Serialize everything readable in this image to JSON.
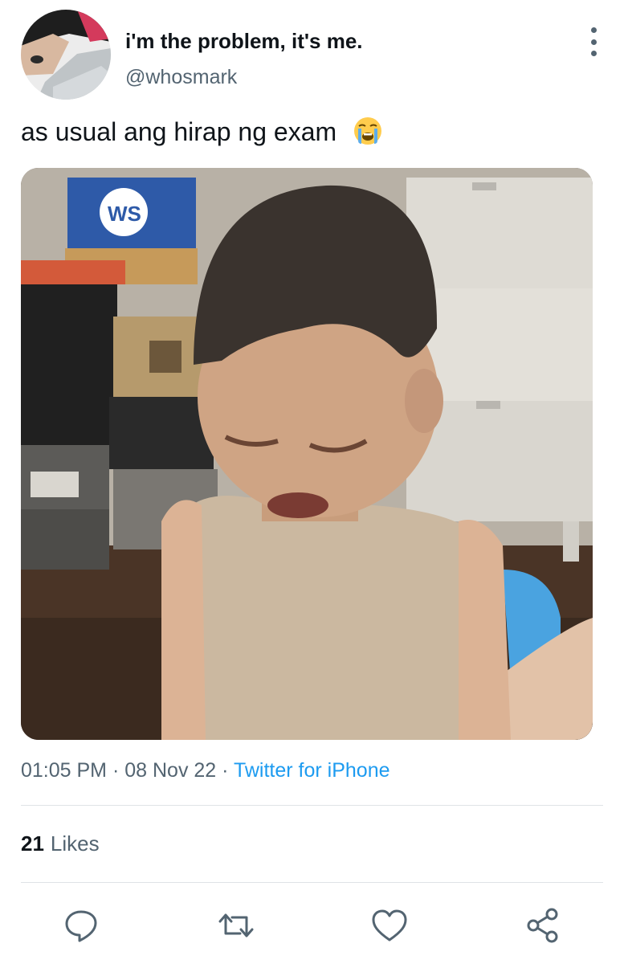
{
  "tweet": {
    "author": {
      "display_name": "i'm the problem, it's me.",
      "handle": "@whosmark"
    },
    "text": "as usual ang hirap ng exam",
    "text_emoji": "loudly-crying-face",
    "media": {
      "description_icon": "crying-child-photo",
      "box_label": "WS"
    },
    "meta": {
      "time": "01:05 PM",
      "separator": " · ",
      "date": "08 Nov 22",
      "source": "Twitter for iPhone"
    },
    "likes": {
      "count": "21",
      "label": "Likes"
    }
  },
  "actions": [
    {
      "name": "reply",
      "icon": "speech-bubble-icon"
    },
    {
      "name": "retweet",
      "icon": "retweet-icon"
    },
    {
      "name": "like",
      "icon": "heart-icon"
    },
    {
      "name": "share",
      "icon": "share-icon"
    }
  ],
  "colors": {
    "text_primary": "#0f1419",
    "text_secondary": "#536471",
    "link": "#1d9bf0",
    "divider": "#dfe3e6"
  }
}
